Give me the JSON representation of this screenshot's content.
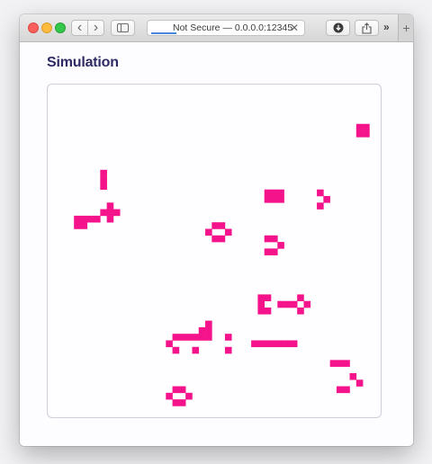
{
  "browser": {
    "address_text": "Not Secure — 0.0.0.0:12345",
    "close_glyph": "✕",
    "back_glyph": "‹",
    "forward_glyph": "›",
    "overflow_glyph": "»",
    "new_tab_glyph": "+"
  },
  "page": {
    "title": "Simulation"
  },
  "simulation": {
    "cell_color": "#f5138c",
    "grid_cols": 51,
    "grid_rows": 51,
    "live_cells": [
      [
        47,
        6
      ],
      [
        48,
        6
      ],
      [
        47,
        7
      ],
      [
        48,
        7
      ],
      [
        8,
        13
      ],
      [
        8,
        14
      ],
      [
        8,
        15
      ],
      [
        33,
        16
      ],
      [
        34,
        16
      ],
      [
        35,
        16
      ],
      [
        33,
        17
      ],
      [
        34,
        17
      ],
      [
        35,
        17
      ],
      [
        41,
        16
      ],
      [
        42,
        17
      ],
      [
        41,
        18
      ],
      [
        9,
        18
      ],
      [
        8,
        19
      ],
      [
        9,
        19
      ],
      [
        10,
        19
      ],
      [
        9,
        20
      ],
      [
        4,
        20
      ],
      [
        5,
        20
      ],
      [
        6,
        20
      ],
      [
        7,
        20
      ],
      [
        4,
        21
      ],
      [
        5,
        21
      ],
      [
        25,
        21
      ],
      [
        26,
        21
      ],
      [
        24,
        22
      ],
      [
        27,
        22
      ],
      [
        25,
        23
      ],
      [
        26,
        23
      ],
      [
        33,
        23
      ],
      [
        34,
        23
      ],
      [
        35,
        24
      ],
      [
        33,
        25
      ],
      [
        34,
        25
      ],
      [
        32,
        32
      ],
      [
        33,
        32
      ],
      [
        32,
        33
      ],
      [
        35,
        33
      ],
      [
        36,
        33
      ],
      [
        32,
        34
      ],
      [
        33,
        34
      ],
      [
        38,
        32
      ],
      [
        37,
        33
      ],
      [
        39,
        33
      ],
      [
        38,
        34
      ],
      [
        24,
        36
      ],
      [
        23,
        37
      ],
      [
        24,
        37
      ],
      [
        20,
        38
      ],
      [
        21,
        38
      ],
      [
        22,
        38
      ],
      [
        23,
        38
      ],
      [
        24,
        38
      ],
      [
        19,
        38
      ],
      [
        18,
        39
      ],
      [
        19,
        40
      ],
      [
        27,
        38
      ],
      [
        31,
        39
      ],
      [
        32,
        39
      ],
      [
        33,
        39
      ],
      [
        34,
        39
      ],
      [
        35,
        39
      ],
      [
        36,
        39
      ],
      [
        37,
        39
      ],
      [
        22,
        40
      ],
      [
        27,
        40
      ],
      [
        43,
        42
      ],
      [
        44,
        42
      ],
      [
        45,
        42
      ],
      [
        46,
        44
      ],
      [
        47,
        45
      ],
      [
        44,
        46
      ],
      [
        45,
        46
      ],
      [
        19,
        46
      ],
      [
        20,
        46
      ],
      [
        18,
        47
      ],
      [
        21,
        47
      ],
      [
        19,
        48
      ],
      [
        20,
        48
      ]
    ]
  }
}
